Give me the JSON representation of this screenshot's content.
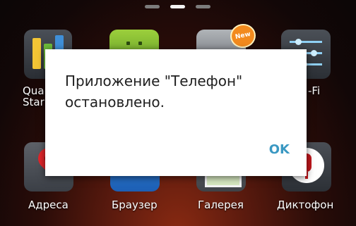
{
  "home": {
    "apps_top": [
      {
        "label_line1": "Qua",
        "label_line2": "Star",
        "icon": "quick-start-icon"
      },
      {
        "label": "",
        "icon": "android-app-icon"
      },
      {
        "label": "",
        "icon": "widget-app-icon",
        "badge": "New"
      },
      {
        "label": "-Fi",
        "icon": "wifi-settings-icon"
      }
    ],
    "apps_bottom": [
      {
        "label": "Адреса",
        "icon": "maps-pin-icon"
      },
      {
        "label": "Браузер",
        "icon": "browser-globe-icon"
      },
      {
        "label": "Галерея",
        "icon": "gallery-icon"
      },
      {
        "label": "Диктофон",
        "icon": "microphone-icon"
      }
    ],
    "page_count": 3,
    "active_page": 2
  },
  "dialog": {
    "message_line1": "Приложение \"Телефон\"",
    "message_line2": "остановлено.",
    "ok_label": "OK"
  },
  "colors": {
    "accent": "#3a98c2",
    "dialog_bg": "#ffffff",
    "badge": "#f28a1e"
  }
}
